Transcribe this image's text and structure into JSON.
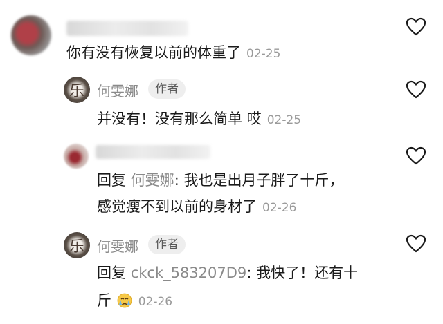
{
  "comments": [
    {
      "text": "你有没有恢复以前的体重了",
      "time": "02-25"
    },
    {
      "author": "何雯娜",
      "tag": "作者",
      "text": "并没有！没有那么简单 哎",
      "time": "02-25"
    },
    {
      "reply_prefix": "回复",
      "reply_to": "何雯娜",
      "text_line1": ": 我也是出月子胖了十斤，",
      "text_line2": "感觉瘦不到以前的身材了",
      "time": "02-26"
    },
    {
      "author": "何雯娜",
      "tag": "作者",
      "reply_prefix": "回复",
      "reply_to": "ckck_583207D9",
      "text_line1": ": 我快了！还有十",
      "text_line2": "斤",
      "time": "02-26"
    }
  ],
  "icons": {
    "like": "heart-outline-icon",
    "emoji": "crying-face-emoji"
  },
  "colors": {
    "meta": "#8a8a8a",
    "time": "#9a9a9a",
    "tag_bg": "#eeeeee"
  }
}
